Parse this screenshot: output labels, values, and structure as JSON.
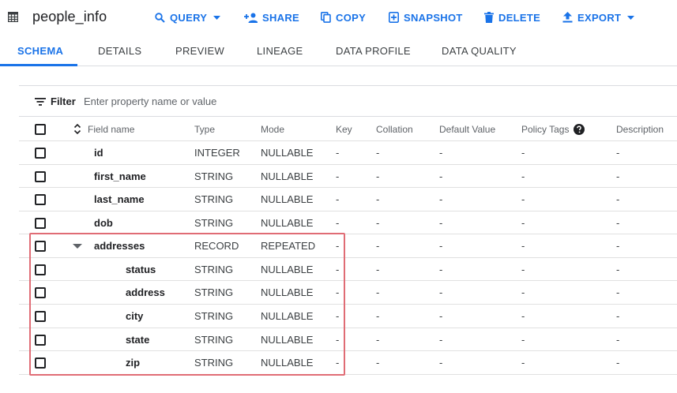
{
  "header": {
    "title": "people_info",
    "actions": {
      "query": "QUERY",
      "share": "SHARE",
      "copy": "COPY",
      "snapshot": "SNAPSHOT",
      "delete": "DELETE",
      "export": "EXPORT"
    }
  },
  "tabs": [
    "SCHEMA",
    "DETAILS",
    "PREVIEW",
    "LINEAGE",
    "DATA PROFILE",
    "DATA QUALITY"
  ],
  "filter": {
    "label": "Filter",
    "placeholder": "Enter property name or value"
  },
  "table": {
    "columns": {
      "field_name": "Field name",
      "type": "Type",
      "mode": "Mode",
      "key": "Key",
      "collation": "Collation",
      "default_value": "Default Value",
      "policy_tags": "Policy Tags",
      "description": "Description"
    },
    "rows": [
      {
        "name": "id",
        "type": "INTEGER",
        "mode": "NULLABLE",
        "key": "-",
        "collation": "-",
        "default_value": "-",
        "policy_tags": "-",
        "description": "-"
      },
      {
        "name": "first_name",
        "type": "STRING",
        "mode": "NULLABLE",
        "key": "-",
        "collation": "-",
        "default_value": "-",
        "policy_tags": "-",
        "description": "-"
      },
      {
        "name": "last_name",
        "type": "STRING",
        "mode": "NULLABLE",
        "key": "-",
        "collation": "-",
        "default_value": "-",
        "policy_tags": "-",
        "description": "-"
      },
      {
        "name": "dob",
        "type": "STRING",
        "mode": "NULLABLE",
        "key": "-",
        "collation": "-",
        "default_value": "-",
        "policy_tags": "-",
        "description": "-"
      },
      {
        "name": "addresses",
        "type": "RECORD",
        "mode": "REPEATED",
        "key": "-",
        "collation": "-",
        "default_value": "-",
        "policy_tags": "-",
        "description": "-"
      },
      {
        "name": "status",
        "type": "STRING",
        "mode": "NULLABLE",
        "key": "-",
        "collation": "-",
        "default_value": "-",
        "policy_tags": "-",
        "description": "-"
      },
      {
        "name": "address",
        "type": "STRING",
        "mode": "NULLABLE",
        "key": "-",
        "collation": "-",
        "default_value": "-",
        "policy_tags": "-",
        "description": "-"
      },
      {
        "name": "city",
        "type": "STRING",
        "mode": "NULLABLE",
        "key": "-",
        "collation": "-",
        "default_value": "-",
        "policy_tags": "-",
        "description": "-"
      },
      {
        "name": "state",
        "type": "STRING",
        "mode": "NULLABLE",
        "key": "-",
        "collation": "-",
        "default_value": "-",
        "policy_tags": "-",
        "description": "-"
      },
      {
        "name": "zip",
        "type": "STRING",
        "mode": "NULLABLE",
        "key": "-",
        "collation": "-",
        "default_value": "-",
        "policy_tags": "-",
        "description": "-"
      }
    ]
  },
  "icons": {
    "table": "table-grid-icon",
    "query": "search-icon",
    "share": "person-add-icon",
    "copy": "copy-icon",
    "snapshot": "snapshot-icon",
    "delete": "trash-icon",
    "export": "upload-icon",
    "filter": "filter-icon",
    "sort": "sort-icon",
    "help": "help-icon",
    "expand": "expand-arrow-icon"
  },
  "colors": {
    "accent": "#1a73e8",
    "highlight": "#e06c75"
  }
}
